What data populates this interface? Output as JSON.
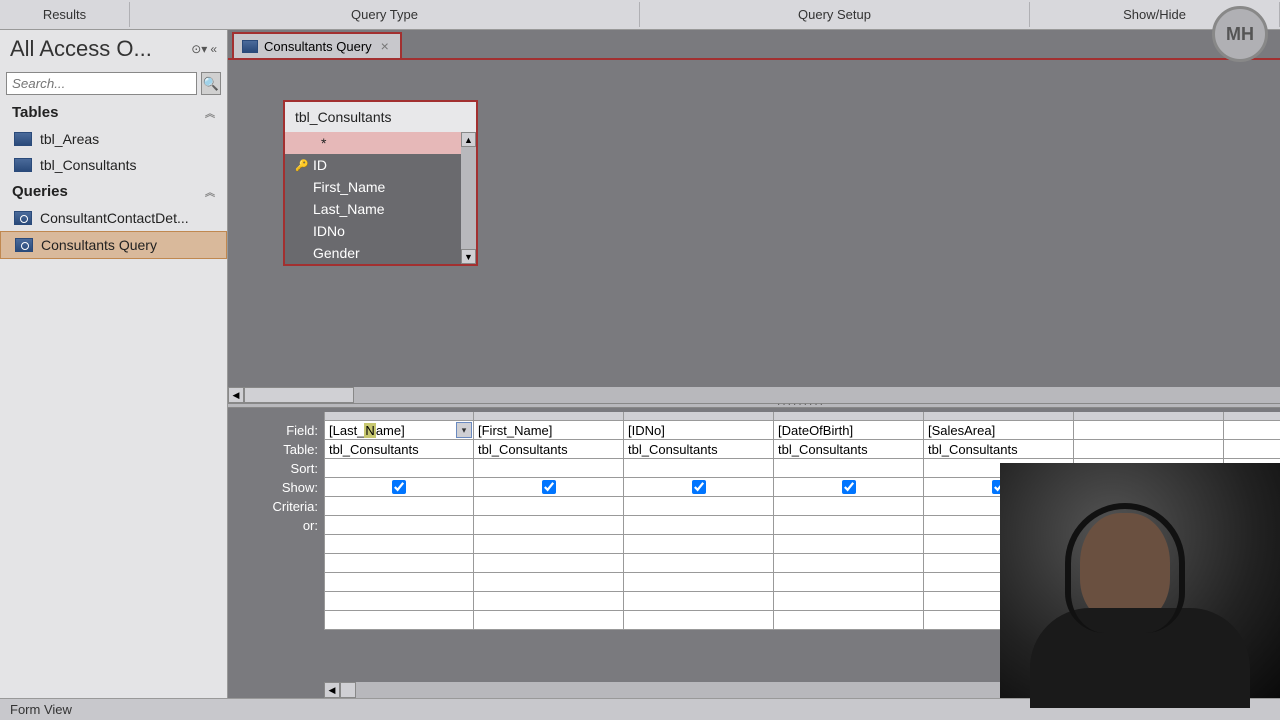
{
  "ribbon": {
    "results": "Results",
    "querytype": "Query Type",
    "querysetup": "Query Setup",
    "showhide": "Show/Hide"
  },
  "nav": {
    "title": "All Access O...",
    "search_placeholder": "Search...",
    "section_tables": "Tables",
    "section_queries": "Queries",
    "tables": [
      "tbl_Areas",
      "tbl_Consultants"
    ],
    "queries": [
      "ConsultantContactDet...",
      "Consultants Query"
    ]
  },
  "tab": {
    "title": "Consultants Query"
  },
  "tablebox": {
    "title": "tbl_Consultants",
    "star": "*",
    "fields": [
      "ID",
      "First_Name",
      "Last_Name",
      "IDNo",
      "Gender"
    ]
  },
  "qbe": {
    "labels": {
      "field": "Field:",
      "table": "Table:",
      "sort": "Sort:",
      "show": "Show:",
      "criteria": "Criteria:",
      "or": "or:"
    },
    "cols": [
      {
        "field_pre": "[Last_",
        "field_hl": "N",
        "field_post": "ame]",
        "table": "tbl_Consultants",
        "show": true,
        "active": true
      },
      {
        "field": "[First_Name]",
        "table": "tbl_Consultants",
        "show": true
      },
      {
        "field": "[IDNo]",
        "table": "tbl_Consultants",
        "show": true
      },
      {
        "field": "[DateOfBirth]",
        "table": "tbl_Consultants",
        "show": true
      },
      {
        "field": "[SalesArea]",
        "table": "tbl_Consultants",
        "show": true
      },
      {
        "field": "",
        "table": "",
        "show": true
      },
      {
        "field": "",
        "table": "",
        "show": false
      }
    ]
  },
  "status": "Form View",
  "badge": "MH"
}
